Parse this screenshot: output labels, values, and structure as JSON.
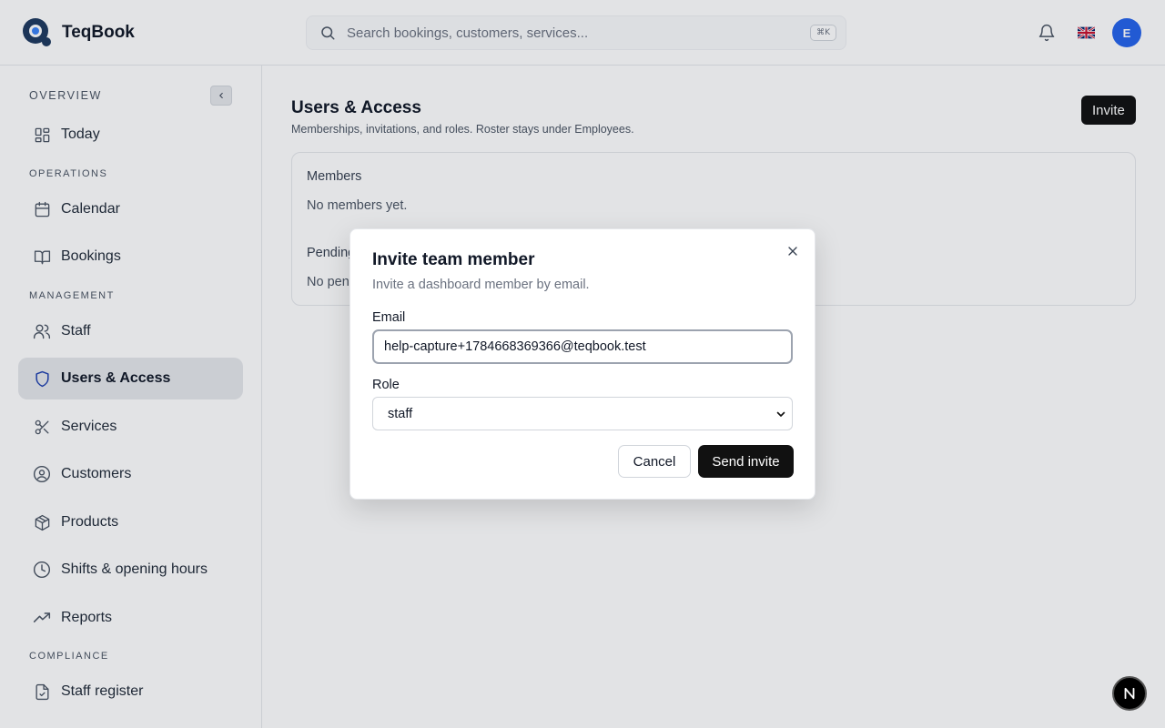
{
  "app": {
    "brand_name": "TeqBook",
    "search_placeholder": "Search bookings, customers, services...",
    "search_shortcut": "⌘K",
    "avatar_initial": "E"
  },
  "sidebar": {
    "sections": {
      "overview": "OVERVIEW",
      "operations": "OPERATIONS",
      "management": "MANAGEMENT",
      "compliance": "COMPLIANCE"
    },
    "items": [
      {
        "label": "Today",
        "icon": "dashboard-icon"
      },
      {
        "label": "Calendar",
        "icon": "calendar-icon"
      },
      {
        "label": "Bookings",
        "icon": "book-icon"
      },
      {
        "label": "Staff",
        "icon": "users-icon"
      },
      {
        "label": "Users & Access",
        "icon": "shield-icon",
        "active": true
      },
      {
        "label": "Services",
        "icon": "scissors-icon"
      },
      {
        "label": "Customers",
        "icon": "user-circle-icon"
      },
      {
        "label": "Products",
        "icon": "package-icon"
      },
      {
        "label": "Shifts & opening hours",
        "icon": "clock-icon"
      },
      {
        "label": "Reports",
        "icon": "trending-up-icon"
      },
      {
        "label": "Staff register",
        "icon": "file-check-icon"
      }
    ]
  },
  "main": {
    "title": "Users & Access",
    "subtitle": "Memberships, invitations, and roles. Roster stays under Employees.",
    "invite_label": "Invite",
    "members_heading": "Members",
    "members_empty": "No members yet.",
    "pending_heading": "Pending",
    "pending_empty": "No pen"
  },
  "modal": {
    "title": "Invite team member",
    "description": "Invite a dashboard member by email.",
    "email_label": "Email",
    "email_value": "help-capture+1784668369366@teqbook.test",
    "role_label": "Role",
    "role_value": "staff",
    "cancel_label": "Cancel",
    "send_label": "Send invite"
  },
  "colors": {
    "accent": "#2563eb",
    "primary_button": "#111111",
    "active_nav": "#e5e7eb"
  }
}
